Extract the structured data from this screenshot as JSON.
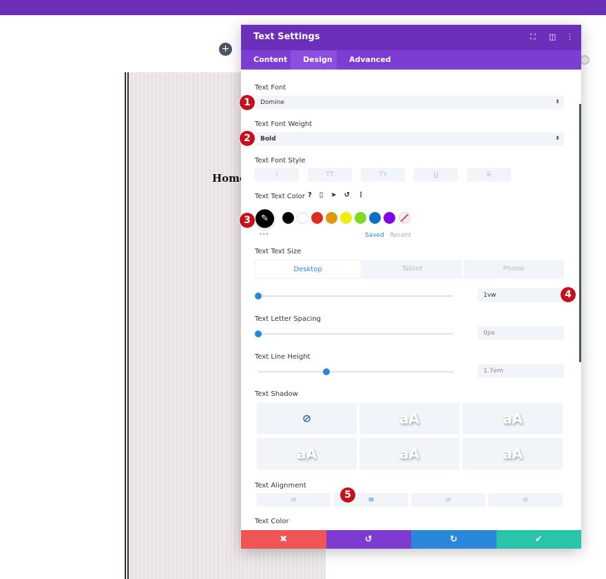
{
  "page": {
    "heading_fragment": "Home"
  },
  "panel": {
    "title": "Text Settings",
    "tabs": [
      {
        "label": "Content"
      },
      {
        "label": "Design"
      },
      {
        "label": "Advanced"
      }
    ],
    "text_font": {
      "label": "Text Font",
      "value": "Domine"
    },
    "text_font_weight": {
      "label": "Text Font Weight",
      "value": "Bold"
    },
    "text_font_style": {
      "label": "Text Font Style",
      "buttons": [
        "I",
        "TT",
        "Tт",
        "U",
        "S"
      ]
    },
    "text_text_color": {
      "label": "Text Text Color",
      "swatches": [
        "#000000",
        "#ffffff",
        "#e02b20",
        "#e09900",
        "#edf000",
        "#7cda24",
        "#0c71c3",
        "#8300e9"
      ],
      "saved": "Saved",
      "recent": "Recent",
      "more": "•••"
    },
    "text_text_size": {
      "label": "Text Text Size",
      "devices": [
        "Desktop",
        "Tablet",
        "Phone"
      ],
      "value": "1vw",
      "slider_fraction": 0
    },
    "text_letter_spacing": {
      "label": "Text Letter Spacing",
      "value": "0px",
      "slider_fraction": 0
    },
    "text_line_height": {
      "label": "Text Line Height",
      "value": "1.7em",
      "slider_fraction": 0.35
    },
    "text_shadow": {
      "label": "Text Shadow",
      "preview": "aA"
    },
    "text_alignment": {
      "label": "Text Alignment",
      "selected": "center"
    },
    "text_color": {
      "label": "Text Color"
    },
    "footer": {
      "cancel": "✖",
      "undo": "↺",
      "redo": "↻",
      "save": "✔"
    },
    "colors": {
      "header": "#6b2fba",
      "tabs": "#7c3ed2",
      "cancel": "#ef5555",
      "undo": "#7e3bd0",
      "redo": "#2b87da",
      "save": "#29c4a9",
      "accent": "#2b87da"
    }
  },
  "badges": [
    "1",
    "2",
    "3",
    "4",
    "5"
  ]
}
